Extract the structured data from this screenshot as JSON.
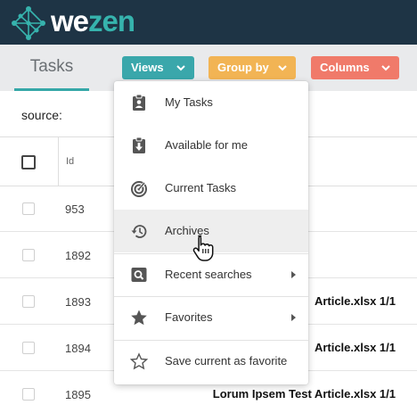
{
  "header": {
    "logo": {
      "part1": "we",
      "part2": "zen",
      "color1": "#ffffff",
      "color2": "#36b3ad"
    },
    "background": "#1e3445"
  },
  "toolbar": {
    "tab_label": "Tasks",
    "views_label": "Views",
    "group_by_label": "Group by",
    "columns_label": "Columns",
    "colors": {
      "views": "#3aa7ab",
      "group_by": "#f2b454",
      "columns": "#f07a6a",
      "accent": "#36a8a8"
    }
  },
  "filter": {
    "source_label": "source:"
  },
  "table": {
    "header": {
      "id_label": "Id"
    },
    "rows": [
      {
        "id": "953",
        "name": ""
      },
      {
        "id": "1892",
        "name": ""
      },
      {
        "id": "1893",
        "name": "Article.xlsx 1/1"
      },
      {
        "id": "1894",
        "name": "Article.xlsx 1/1"
      },
      {
        "id": "1895",
        "name": "Lorum Ipsem Test Article.xlsx 1/1"
      }
    ]
  },
  "views_menu": {
    "items": [
      {
        "label": "My Tasks",
        "icon": "clipboard-user-icon"
      },
      {
        "label": "Available for me",
        "icon": "clipboard-download-icon"
      },
      {
        "label": "Current Tasks",
        "icon": "target-icon"
      },
      {
        "label": "Archives",
        "icon": "history-icon",
        "hovered": true
      },
      {
        "label": "Recent searches",
        "icon": "search-box-icon",
        "submenu": true
      },
      {
        "label": "Favorites",
        "icon": "star-filled-icon",
        "submenu": true
      },
      {
        "label": "Save current as favorite",
        "icon": "star-outline-icon"
      }
    ]
  }
}
